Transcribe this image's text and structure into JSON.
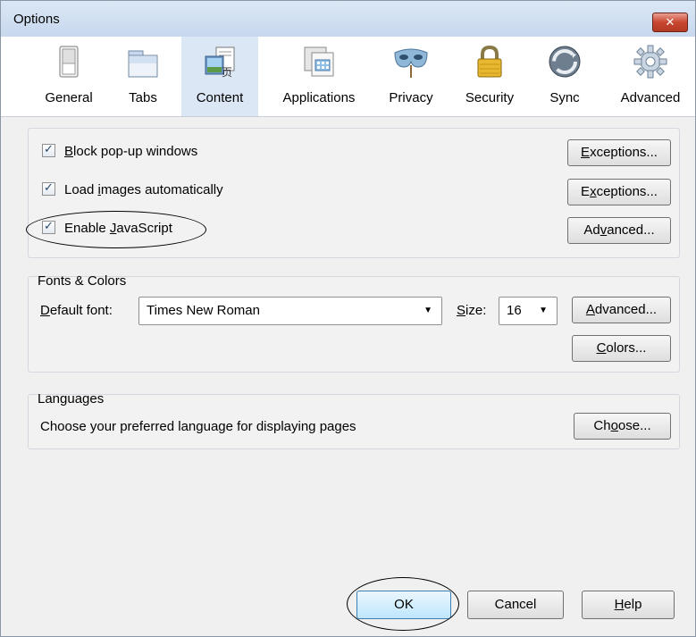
{
  "window": {
    "title": "Options",
    "close_label": "✕"
  },
  "toolbar": {
    "panes": [
      {
        "label": "General",
        "icon": "switch-icon"
      },
      {
        "label": "Tabs",
        "icon": "tabs-icon"
      },
      {
        "label": "Content",
        "icon": "content-icon",
        "selected": true
      },
      {
        "label": "Applications",
        "icon": "applications-icon"
      },
      {
        "label": "Privacy",
        "icon": "mask-icon"
      },
      {
        "label": "Security",
        "icon": "lock-icon"
      },
      {
        "label": "Sync",
        "icon": "sync-icon"
      },
      {
        "label": "Advanced",
        "icon": "gear-icon"
      }
    ]
  },
  "content": {
    "block_popups": {
      "pre": "",
      "accel": "B",
      "post": "lock pop-up windows",
      "checked": true,
      "button_pre": "",
      "button_accel": "E",
      "button_post": "xceptions..."
    },
    "load_images": {
      "pre": "Load ",
      "accel": "i",
      "post": "mages automatically",
      "checked": true,
      "button_pre": "E",
      "button_accel": "x",
      "button_post": "ceptions..."
    },
    "javascript": {
      "pre": "Enable ",
      "accel": "J",
      "post": "avaScript",
      "checked": true,
      "button_pre": "Ad",
      "button_accel": "v",
      "button_post": "anced..."
    }
  },
  "fonts_colors": {
    "legend": "Fonts & Colors",
    "default_font_label_accel": "D",
    "default_font_label_post": "efault font:",
    "default_font_value": "Times New Roman",
    "size_label_accel": "S",
    "size_label_post": "ize:",
    "size_value": "16",
    "advanced_accel": "A",
    "advanced_post": "dvanced...",
    "colors_accel": "C",
    "colors_post": "olors..."
  },
  "languages": {
    "legend": "Languages",
    "description": "Choose your preferred language for displaying pages",
    "choose_pre": "Ch",
    "choose_accel": "o",
    "choose_post": "ose..."
  },
  "footer": {
    "ok_label": "OK",
    "cancel_label": "Cancel",
    "help_accel": "H",
    "help_post": "elp"
  },
  "colors": {
    "selected_pane_bg": "#dbe7f5",
    "close_button_red": "#c8462f",
    "default_button_border": "#3c7fb1"
  }
}
